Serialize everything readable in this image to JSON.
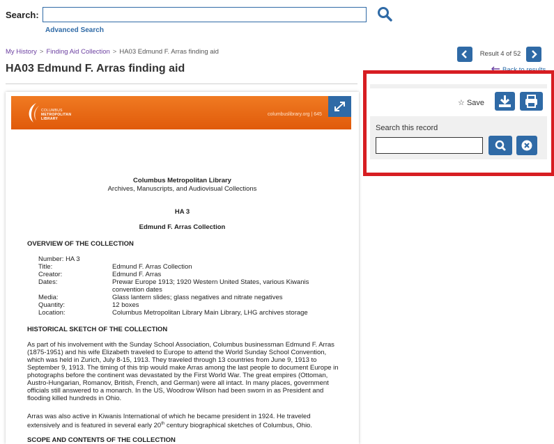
{
  "search": {
    "label": "Search:",
    "placeholder": "",
    "advanced": "Advanced Search"
  },
  "breadcrumb": {
    "items": [
      "My History",
      "Finding Aid Collection",
      "HA03 Edmund F. Arras finding aid"
    ]
  },
  "title": "HA03 Edmund F. Arras finding aid",
  "pager": {
    "result_text": "Result 4 of 52",
    "back": "Back to results"
  },
  "tools": {
    "save_label": "Save",
    "search_record_label": "Search this record"
  },
  "document": {
    "banner_logo_line1": "COLUMBUS",
    "banner_logo_line2": "METROPOLITAN",
    "banner_logo_line3": "LIBRARY",
    "banner_url": "columbuslibrary.org | 645",
    "heading1": "Columbus Metropolitan Library",
    "heading2": "Archives, Manuscripts, and Audiovisual Collections",
    "code": "HA 3",
    "collection": "Edmund F. Arras Collection",
    "overview_heading": "OVERVIEW OF THE COLLECTION",
    "overview": [
      {
        "key": "Number: HA 3",
        "value": ""
      },
      {
        "key": "Title:",
        "value": "Edmund F. Arras Collection"
      },
      {
        "key": "Creator:",
        "value": "Edmund F. Arras"
      },
      {
        "key": "Dates:",
        "value": "Prewar Europe 1913; 1920 Western United States, various Kiwanis convention dates"
      },
      {
        "key": "Media:",
        "value": "Glass lantern slides; glass negatives and nitrate negatives"
      },
      {
        "key": "Quantity:",
        "value": "12 boxes"
      },
      {
        "key": "Location:",
        "value": "Columbus Metropolitan Library Main Library, LHG archives storage"
      }
    ],
    "history_heading": "HISTORICAL SKETCH OF THE COLLECTION",
    "history_p1": "As part of his involvement with the Sunday School Association, Columbus businessman Edmund F. Arras (1875-1951) and his wife Elizabeth traveled to Europe to attend the World Sunday School Convention, which was held in Zurich, July 8-15, 1913. They traveled through 13 countries from June 9, 1913 to September 9, 1913. The timing of this trip would make Arras among the last people to document Europe in photographs before the continent was devastated by the First World War. The great empires (Ottoman, Austro-Hungarian, Romanov, British, French, and German) were all intact. In many places, government officials still answered to a monarch. In the US, Woodrow Wilson had been sworn in as President and flooding killed hundreds in Ohio.",
    "history_p2a": "Arras was also active in Kiwanis International of which he became president in 1924.  He traveled extensively and is featured in several early 20",
    "history_p2sup": "th",
    "history_p2b": " century biographical sketches of Columbus, Ohio.",
    "scope_heading": "SCOPE AND CONTENTS OF THE COLLECTION"
  },
  "colors": {
    "accent": "#2f6aa6",
    "highlight": "#d71d22",
    "banner": "#ef6f1c"
  }
}
